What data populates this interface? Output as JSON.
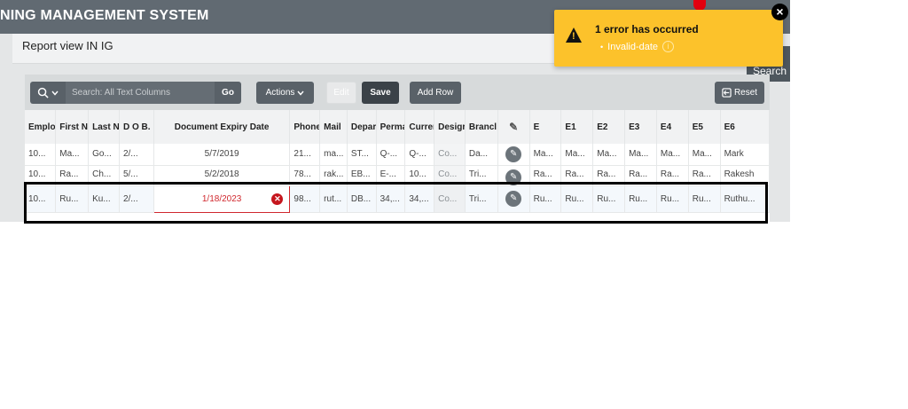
{
  "header": {
    "title": "NING MANAGEMENT SYSTEM"
  },
  "report": {
    "title": "Report view IN IG"
  },
  "search_button": {
    "label": "Search"
  },
  "toolbar": {
    "search_placeholder": "Search: All Text Columns",
    "go_label": "Go",
    "actions_label": "Actions",
    "edit_label": "Edit",
    "save_label": "Save",
    "add_row_label": "Add Row",
    "reset_label": "Reset"
  },
  "grid": {
    "columns": [
      "Emplo",
      "First N",
      "Last N",
      "D O B.",
      "Document Expiry Date",
      "Phone",
      "Mail",
      "Depar",
      "Perma",
      "Currer",
      "Desigr",
      "Brancl",
      "",
      "E",
      "E1",
      "E2",
      "E3",
      "E4",
      "E5",
      "E6"
    ],
    "rows": [
      [
        "10...",
        "Ma...",
        "Go...",
        "2/...",
        "5/7/2019",
        "21...",
        "ma...",
        "ST...",
        "Q-...",
        "Q-...",
        "Co...",
        "Da...",
        "",
        "Ma...",
        "Ma...",
        "Ma...",
        "Ma...",
        "Ma...",
        "Ma...",
        "Mark"
      ],
      [
        "10...",
        "Ra...",
        "Ch...",
        "5/...",
        "5/2/2018",
        "78...",
        "rak...",
        "EB...",
        "E-...",
        "10...",
        "Co...",
        "Tri...",
        "",
        "Ra...",
        "Ra...",
        "Ra...",
        "Ra...",
        "Ra...",
        "Ra...",
        "Rakesh"
      ],
      [
        "10...",
        "Ru...",
        "Ku...",
        "2/...",
        "1/18/2023",
        "98...",
        "rut...",
        "DB...",
        "34,...",
        "34,...",
        "Co...",
        "Tri...",
        "",
        "Ru...",
        "Ru...",
        "Ru...",
        "Ru...",
        "Ru...",
        "Ru...",
        "Ruthu..."
      ]
    ]
  },
  "toast": {
    "title": "1 error has occurred",
    "items": [
      "Invalid-date"
    ]
  },
  "colors": {
    "header": "#616a72",
    "toast": "#fcc22b",
    "error": "#d0282e"
  }
}
